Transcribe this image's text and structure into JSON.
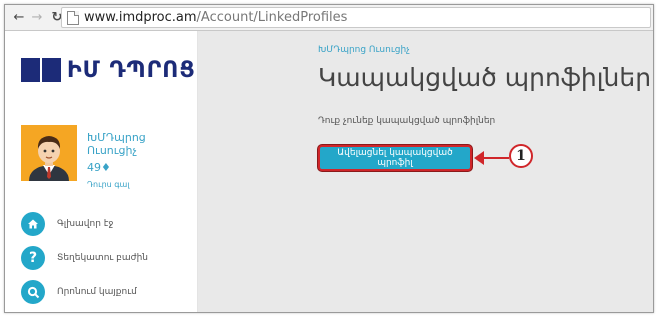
{
  "browser": {
    "url_domain": "www.imdproc.am",
    "url_path": "/Account/LinkedProfiles"
  },
  "sidebar": {
    "logo_text": "ԻՄ ԴՊՐՈՑ",
    "profile": {
      "name": "ԽՄԴպրոց Ուսուցիչ",
      "score": "49♦",
      "logout": "Դուրս գալ"
    },
    "menu": [
      {
        "label": "Գլխավոր էջ",
        "icon": "home-icon"
      },
      {
        "label": "Տեղեկատու բաժին",
        "icon": "question-icon"
      },
      {
        "label": "Որոնում կայքում",
        "icon": "search-icon"
      }
    ]
  },
  "main": {
    "breadcrumb": "ԽՄԴպրոց Ուսուցիչ",
    "title": "Կապակցված պրոֆիլներ",
    "empty_text": "Դուք չունեք կապակցված պրոֆիլներ",
    "add_button": "Ավելացնել կապակցված պրոֆիլ",
    "callout_number": "1"
  },
  "colors": {
    "accent": "#23a7c9",
    "logo": "#1c2b78",
    "callout": "#d0262a",
    "main_bg": "#e9e9e9"
  }
}
